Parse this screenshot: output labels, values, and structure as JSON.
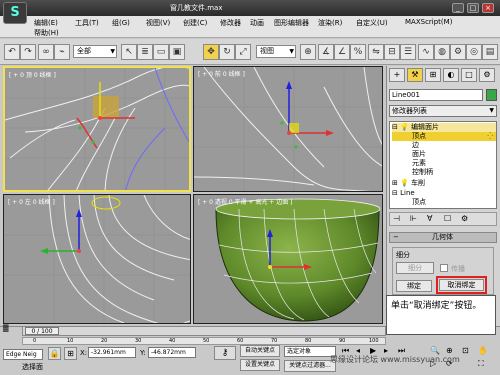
{
  "window": {
    "title": "窗几教文件.max",
    "controls": [
      "_",
      "□",
      "×"
    ]
  },
  "menu": {
    "items": [
      "编辑(E)",
      "工具(T)",
      "组(G)",
      "视图(V)",
      "创建(C)",
      "修改器",
      "动画",
      "图形编辑器",
      "渲染(R)",
      "自定义(U)",
      "MAXScript(M)",
      "帮助(H)"
    ]
  },
  "toolbar": {
    "filter": "全部",
    "coord_system": "视图",
    "icons": [
      "undo-icon",
      "redo-icon",
      "link-icon",
      "unlink-icon",
      "bind-icon",
      "select-icon",
      "select-region-icon",
      "move-icon",
      "rotate-icon",
      "scale-icon",
      "snap-icon",
      "angle-snap-icon",
      "percent-snap-icon",
      "mirror-icon",
      "align-icon",
      "layers-icon",
      "curve-editor-icon",
      "schematic-icon",
      "material-icon",
      "render-setup-icon",
      "render-icon"
    ]
  },
  "viewports": [
    {
      "label": "[ + 0 顶 0 线框 ]"
    },
    {
      "label": "[ + 0 前 0 线框 ]"
    },
    {
      "label": "[ + 0 左 0 线框 ]"
    },
    {
      "label": "[ + 0 透视 0 平滑 + 高光 + 边面 ]"
    }
  ],
  "panel": {
    "tabs": [
      "+",
      "⚒",
      "⊞",
      "◐",
      "□",
      "⚙"
    ],
    "object_name": "Line001",
    "object_color": "#3aa64a",
    "modifier_list": "修改器列表",
    "stack": [
      {
        "label": "编辑面片",
        "level": 0,
        "expand": "−"
      },
      {
        "label": "顶点",
        "level": 1,
        "selected": true
      },
      {
        "label": "边",
        "level": 1
      },
      {
        "label": "面片",
        "level": 1
      },
      {
        "label": "元素",
        "level": 1
      },
      {
        "label": "控制柄",
        "level": 1
      },
      {
        "label": "车削",
        "level": 0,
        "expand": "+"
      },
      {
        "label": "Line",
        "level": 0,
        "expand": "−"
      },
      {
        "label": "顶点",
        "level": 1
      }
    ],
    "rollout_title": "几何体",
    "group_label": "细分",
    "subdivide_btn": "细分",
    "propagate_label": "传播",
    "bind_btn": "绑定",
    "unbind_btn": "取消绑定"
  },
  "callout": {
    "text": "单击“取消绑定”按钮。"
  },
  "timeline": {
    "frame": "0 / 100",
    "ticks": [
      "0",
      "10",
      "20",
      "30",
      "40",
      "50",
      "60",
      "70",
      "80",
      "90",
      "100"
    ]
  },
  "status": {
    "script_label": "Edge Neig",
    "x_label": "X:",
    "x_value": "-32.961mm",
    "y_label": "Y:",
    "y_value": "-46.872mm",
    "status_text": "选择面",
    "auto_key": "自动关键点",
    "set_key": "设置关键点",
    "selected_label": "选定对象",
    "key_filter": "关键点过滤器..."
  },
  "watermark": {
    "text": "思缘设计论坛 www.missyuan.com"
  }
}
